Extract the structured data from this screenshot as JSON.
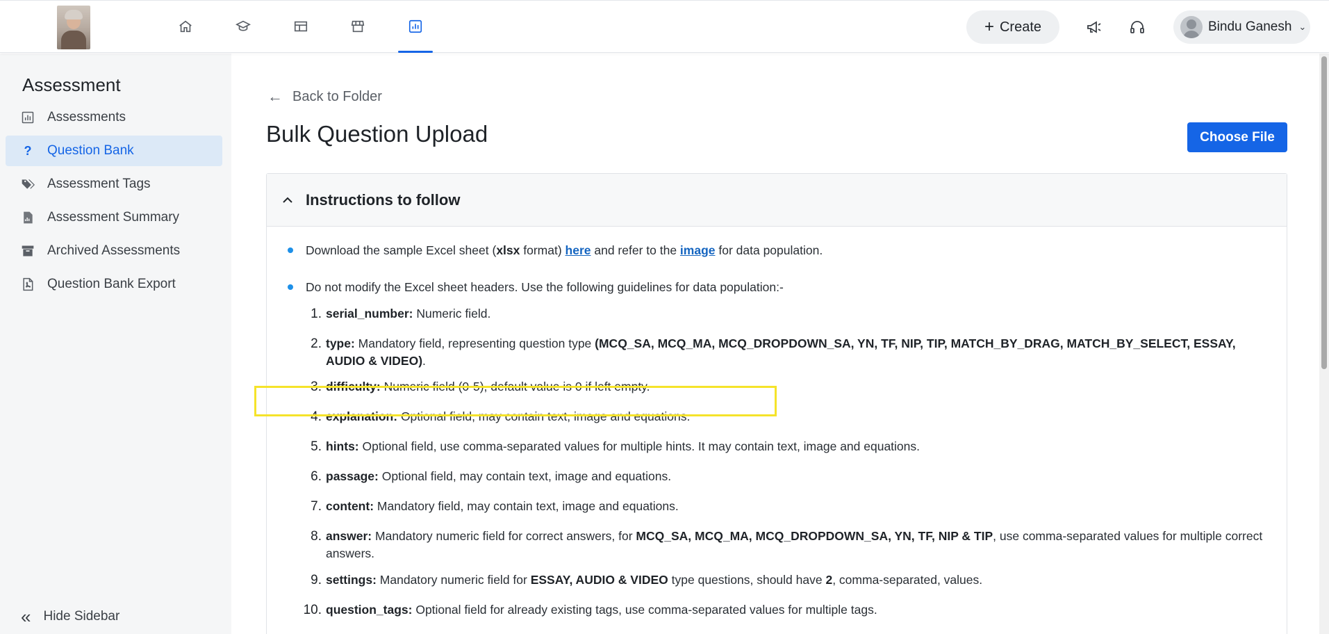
{
  "header": {
    "nav": [
      "home-icon",
      "course-icon",
      "dashboard-icon",
      "store-icon",
      "analytics-icon"
    ],
    "active_nav": "analytics-icon",
    "create_label": "Create",
    "user_name": "Bindu Ganesh"
  },
  "sidebar": {
    "title": "Assessment",
    "items": [
      {
        "label": "Assessments",
        "icon": "bar-chart-icon"
      },
      {
        "label": "Question Bank",
        "icon": "question-icon",
        "active": true
      },
      {
        "label": "Assessment Tags",
        "icon": "tag-icon"
      },
      {
        "label": "Assessment Summary",
        "icon": "report-icon"
      },
      {
        "label": "Archived Assessments",
        "icon": "archive-icon"
      },
      {
        "label": "Question Bank Export",
        "icon": "pdf-file-icon"
      }
    ],
    "hide_label": "Hide Sidebar"
  },
  "main": {
    "back_label": "Back to Folder",
    "title": "Bulk Question Upload",
    "choose_file_label": "Choose File",
    "panel_title": "Instructions to follow",
    "bullet1": {
      "pre": "Download the sample Excel sheet (",
      "bold": "xlsx",
      "mid": " format) ",
      "link1": "here",
      "mid2": " and refer to the ",
      "link2": "image",
      "post": " for data population."
    },
    "bullet2": "Do not modify the Excel sheet headers. Use the following guidelines for data population:-",
    "fields": [
      {
        "num": "1.",
        "name": "serial_number:",
        "desc": " Numeric field."
      },
      {
        "num": "2.",
        "name": "type:",
        "desc": " Mandatory field, representing question type ",
        "bold_tail": "(MCQ_SA, MCQ_MA, MCQ_DROPDOWN_SA, YN, TF, NIP, TIP, MATCH_BY_DRAG, MATCH_BY_SELECT, ESSAY, AUDIO & VIDEO)",
        "tail": "."
      },
      {
        "num": "3.",
        "name": "difficulty:",
        "desc": " Numeric field (0-5), default value is 0 if left empty."
      },
      {
        "num": "4.",
        "name": "explanation:",
        "desc": " Optional field, may contain text, image and equations."
      },
      {
        "num": "5.",
        "name": "hints:",
        "desc": " Optional field, use comma-separated values for multiple hints. It may contain text, image and equations."
      },
      {
        "num": "6.",
        "name": "passage:",
        "desc": " Optional field, may contain text, image and equations."
      },
      {
        "num": "7.",
        "name": "content:",
        "desc": " Mandatory field, may contain text, image and equations."
      },
      {
        "num": "8.",
        "name": "answer:",
        "desc": " Mandatory numeric field for correct answers, for ",
        "bold_mid": "MCQ_SA, MCQ_MA, MCQ_DROPDOWN_SA, YN, TF, NIP & TIP",
        "tail": ", use comma-separated values for multiple correct answers."
      },
      {
        "num": "9.",
        "name": "settings:",
        "desc": " Mandatory numeric field for ",
        "bold_mid": "ESSAY, AUDIO & VIDEO",
        "mid2": " type questions, should have ",
        "bold_mid2": "2",
        "tail": ", comma-separated, values."
      },
      {
        "num": "10.",
        "name": "question_tags:",
        "desc": " Optional field for already existing tags, use comma-separated values for multiple tags."
      }
    ]
  },
  "colors": {
    "accent": "#1565e6",
    "highlight": "#f5e32a",
    "sidebar_bg": "#f5f6f7"
  }
}
